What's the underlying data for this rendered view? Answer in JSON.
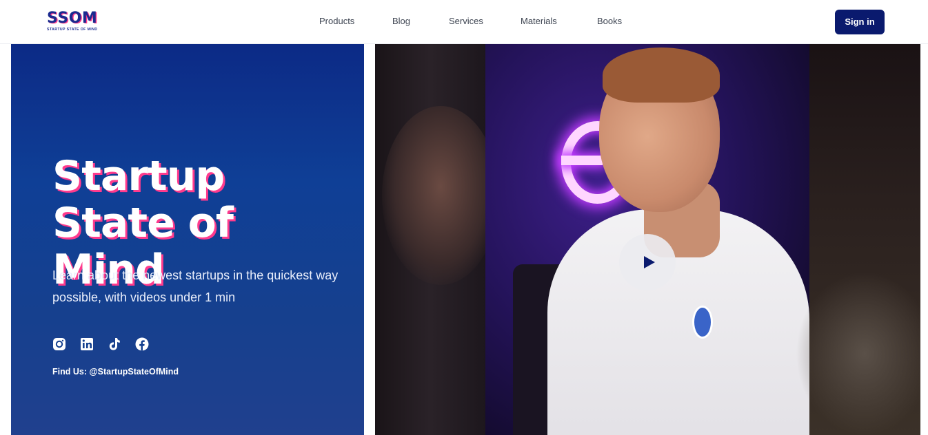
{
  "brand": {
    "logo_text": "SSOM",
    "logo_subtext": "STARTUP STATE OF MIND"
  },
  "nav": {
    "items": [
      {
        "label": "Products"
      },
      {
        "label": "Blog"
      },
      {
        "label": "Services"
      },
      {
        "label": "Materials"
      },
      {
        "label": "Books"
      }
    ],
    "signin_label": "Sign in"
  },
  "hero": {
    "title": "Startup State of Mind",
    "subtitle": "Learn about the newest startups in the quickest way possible, with videos under 1 min",
    "socials": [
      {
        "icon": "instagram-icon"
      },
      {
        "icon": "linkedin-icon"
      },
      {
        "icon": "tiktok-icon"
      },
      {
        "icon": "facebook-icon"
      }
    ],
    "find_us": "Find Us: @StartupStateOfMind"
  },
  "video": {
    "play_icon": "play-icon"
  },
  "colors": {
    "brand_navy": "#0a1a6e",
    "accent_pink": "#ff3b8d",
    "hero_blue": "#0f3f96"
  }
}
